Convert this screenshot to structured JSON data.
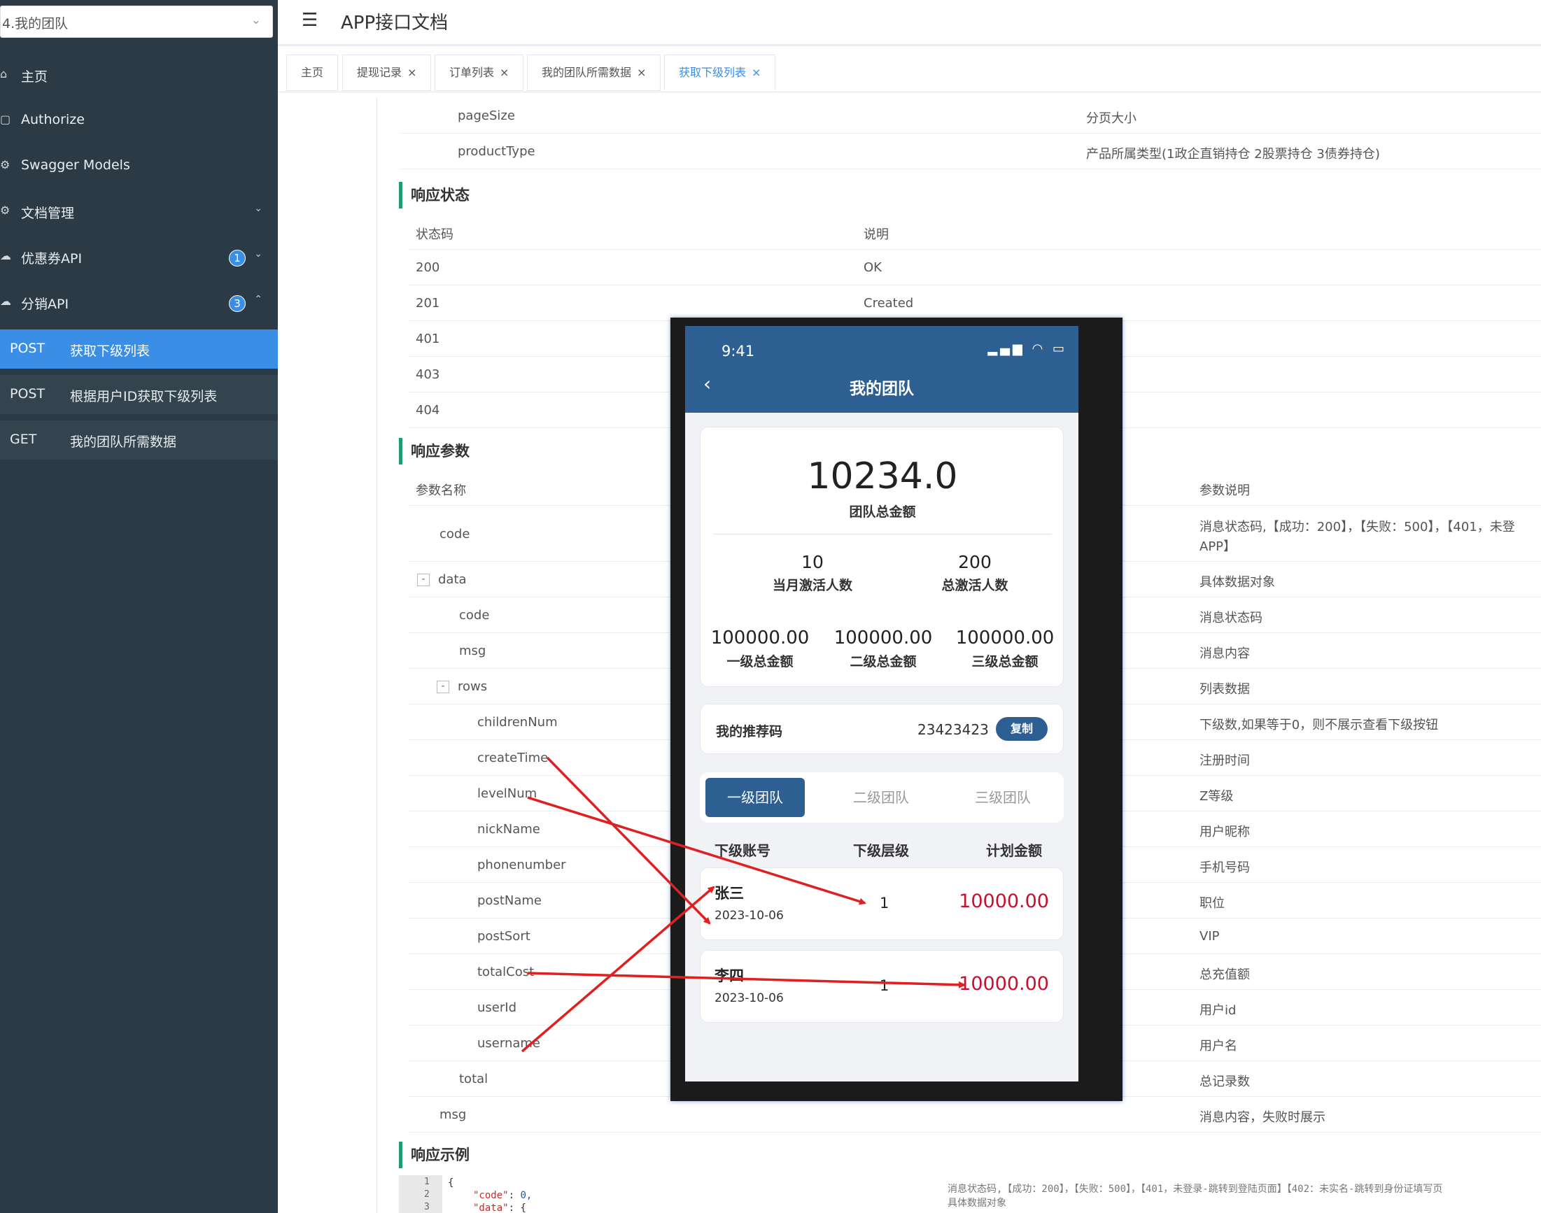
{
  "sidebar": {
    "select_value": "4.我的团队",
    "menu": [
      {
        "label": "主页"
      },
      {
        "label": "Authorize"
      },
      {
        "label": "Swagger Models"
      },
      {
        "label": "文档管理"
      },
      {
        "label": "优惠券API",
        "badge": "1"
      },
      {
        "label": "分销API",
        "badge": "3"
      }
    ],
    "sub_items": [
      {
        "method": "POST",
        "label": "获取下级列表"
      },
      {
        "method": "POST",
        "label": "根据用户ID获取下级列表"
      },
      {
        "method": "GET",
        "label": "我的团队所需数据"
      }
    ]
  },
  "header": {
    "title": "APP接口文档"
  },
  "tabs": [
    "主页",
    "提现记录",
    "订单列表",
    "我的团队所需数据",
    "获取下级列表"
  ],
  "request_params_tail": [
    {
      "name": "pageSize",
      "desc": "分页大小"
    },
    {
      "name": "productType",
      "desc": "产品所属类型(1政企直销持仓 2股票持仓 3债券持仓)"
    }
  ],
  "response_status": {
    "title": "响应状态",
    "headers": [
      "状态码",
      "说明"
    ],
    "rows": [
      {
        "code": "200",
        "desc": "OK"
      },
      {
        "code": "201",
        "desc": "Created"
      },
      {
        "code": "401",
        "desc": ""
      },
      {
        "code": "403",
        "desc": ""
      },
      {
        "code": "404",
        "desc": ""
      }
    ]
  },
  "response_params": {
    "title": "响应参数",
    "headers": [
      "参数名称",
      "参数说明"
    ],
    "rows": [
      {
        "name": "code",
        "desc": "消息状态码,【成功：200】，【失败：500】，【401，未登",
        "desc2": "APP】"
      },
      {
        "name": "data",
        "desc": "具体数据对象",
        "toggle": "-"
      },
      {
        "name": "code",
        "desc": "消息状态码"
      },
      {
        "name": "msg",
        "desc": "消息内容"
      },
      {
        "name": "rows",
        "desc": "列表数据",
        "toggle": "-"
      },
      {
        "name": "childrenNum",
        "desc": "下级数,如果等于0，则不展示查看下级按钮"
      },
      {
        "name": "createTime",
        "desc": "注册时间"
      },
      {
        "name": "levelNum",
        "desc": "Z等级"
      },
      {
        "name": "nickName",
        "desc": "用户昵称"
      },
      {
        "name": "phonenumber",
        "desc": "手机号码"
      },
      {
        "name": "postName",
        "desc": "职位"
      },
      {
        "name": "postSort",
        "desc": "VIP"
      },
      {
        "name": "totalCost",
        "desc": "总充值额"
      },
      {
        "name": "userId",
        "desc": "用户id"
      },
      {
        "name": "username",
        "desc": "用户名"
      },
      {
        "name": "total",
        "desc": "总记录数"
      },
      {
        "name": "msg",
        "desc": "消息内容，失败时展示"
      }
    ]
  },
  "response_example": {
    "title": "响应示例",
    "gutter": [
      "1",
      "2",
      "3"
    ],
    "line1": "{",
    "line2_key": "\"code\"",
    "line2_val": "0,",
    "line3_key": "\"data\"",
    "line3_val": "{",
    "tail1": "消息状态码,【成功：200】，【失败：500】，【401，未登录-跳转到登陆页面】【402：未实名-跳转到身份证填写页",
    "tail2": "具体数据对象"
  },
  "phone": {
    "time": "9:41",
    "title": "我的团队",
    "total_amount": "10234.0",
    "total_label": "团队总金额",
    "stats": [
      {
        "value": "10",
        "label": "当月激活人数"
      },
      {
        "value": "200",
        "label": "总激活人数"
      }
    ],
    "levels": [
      {
        "value": "100000.00",
        "label": "一级总金额"
      },
      {
        "value": "100000.00",
        "label": "二级总金额"
      },
      {
        "value": "100000.00",
        "label": "三级总金额"
      }
    ],
    "referral_label": "我的推荐码",
    "referral_code": "23423423",
    "copy_label": "复制",
    "team_tabs": [
      "一级团队",
      "二级团队",
      "三级团队"
    ],
    "columns": [
      "下级账号",
      "下级层级",
      "计划金额"
    ],
    "members": [
      {
        "name": "张三",
        "date": "2023-10-06",
        "level": "1",
        "amount": "10000.00"
      },
      {
        "name": "李四",
        "date": "2023-10-06",
        "level": "1",
        "amount": "10000.00"
      }
    ]
  },
  "colors": {
    "accent": "#3a8ee6",
    "sidebar": "#2b3a45",
    "phone_header": "#2d5f92",
    "amount": "#c8102e",
    "arrow": "#e02020",
    "section_bar": "#1f9b6e"
  }
}
